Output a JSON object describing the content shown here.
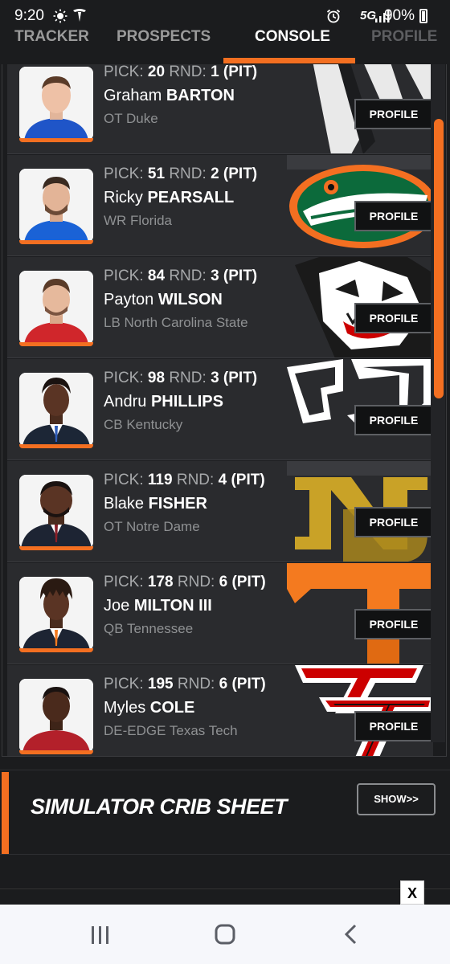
{
  "status_bar": {
    "time": "9:20",
    "network": "5G",
    "battery": "90%",
    "icons": [
      "brightness-icon",
      "tesla-icon",
      "alarm-icon",
      "signal-icon",
      "battery-icon"
    ]
  },
  "tabs": [
    {
      "label": "TRACKER",
      "active": false
    },
    {
      "label": "PROSPECTS",
      "active": false
    },
    {
      "label": "CONSOLE",
      "active": true
    },
    {
      "label": "PROFILE",
      "active": false
    }
  ],
  "labels": {
    "pick": "PICK:",
    "rnd": "RND:",
    "profile_button": "PROFILE"
  },
  "picks": [
    {
      "pick": "20",
      "round": "1",
      "team": "(PIT)",
      "first_name": "Graham",
      "last_name": "BARTON",
      "position_school": "OT Duke",
      "logo": "duke-logo",
      "jersey_color": "#1f55c8"
    },
    {
      "pick": "51",
      "round": "2",
      "team": "(PIT)",
      "first_name": "Ricky",
      "last_name": "PEARSALL",
      "position_school": "WR Florida",
      "logo": "florida-gator-logo",
      "jersey_color": "#1a62d6"
    },
    {
      "pick": "84",
      "round": "3",
      "team": "(PIT)",
      "first_name": "Payton",
      "last_name": "WILSON",
      "position_school": "LB North Carolina State",
      "logo": "nc-state-wolf-logo",
      "jersey_color": "#d0262b"
    },
    {
      "pick": "98",
      "round": "3",
      "team": "(PIT)",
      "first_name": "Andru",
      "last_name": "PHILLIPS",
      "position_school": "CB Kentucky",
      "logo": "kentucky-logo",
      "jersey_color": "#1c2636"
    },
    {
      "pick": "119",
      "round": "4",
      "team": "(PIT)",
      "first_name": "Blake",
      "last_name": "FISHER",
      "position_school": "OT Notre Dame",
      "logo": "notre-dame-logo",
      "jersey_color": "#1d2433"
    },
    {
      "pick": "178",
      "round": "6",
      "team": "(PIT)",
      "first_name": "Joe",
      "last_name": "MILTON III",
      "position_school": "QB Tennessee",
      "logo": "tennessee-logo",
      "jersey_color": "#1d2433"
    },
    {
      "pick": "195",
      "round": "6",
      "team": "(PIT)",
      "first_name": "Myles",
      "last_name": "COLE",
      "position_school": "DE-EDGE Texas Tech",
      "logo": "texas-tech-logo",
      "jersey_color": "#b3202a"
    }
  ],
  "crib_sheet": {
    "title": "SIMULATOR CRIB SHEET",
    "button": "SHOW>>"
  },
  "ad_close": "X",
  "colors": {
    "accent": "#f36f21",
    "background": "#1b1c1e",
    "card": "#2a2b2e"
  },
  "nav_bar": [
    "recent-apps-icon",
    "home-icon",
    "back-icon"
  ]
}
